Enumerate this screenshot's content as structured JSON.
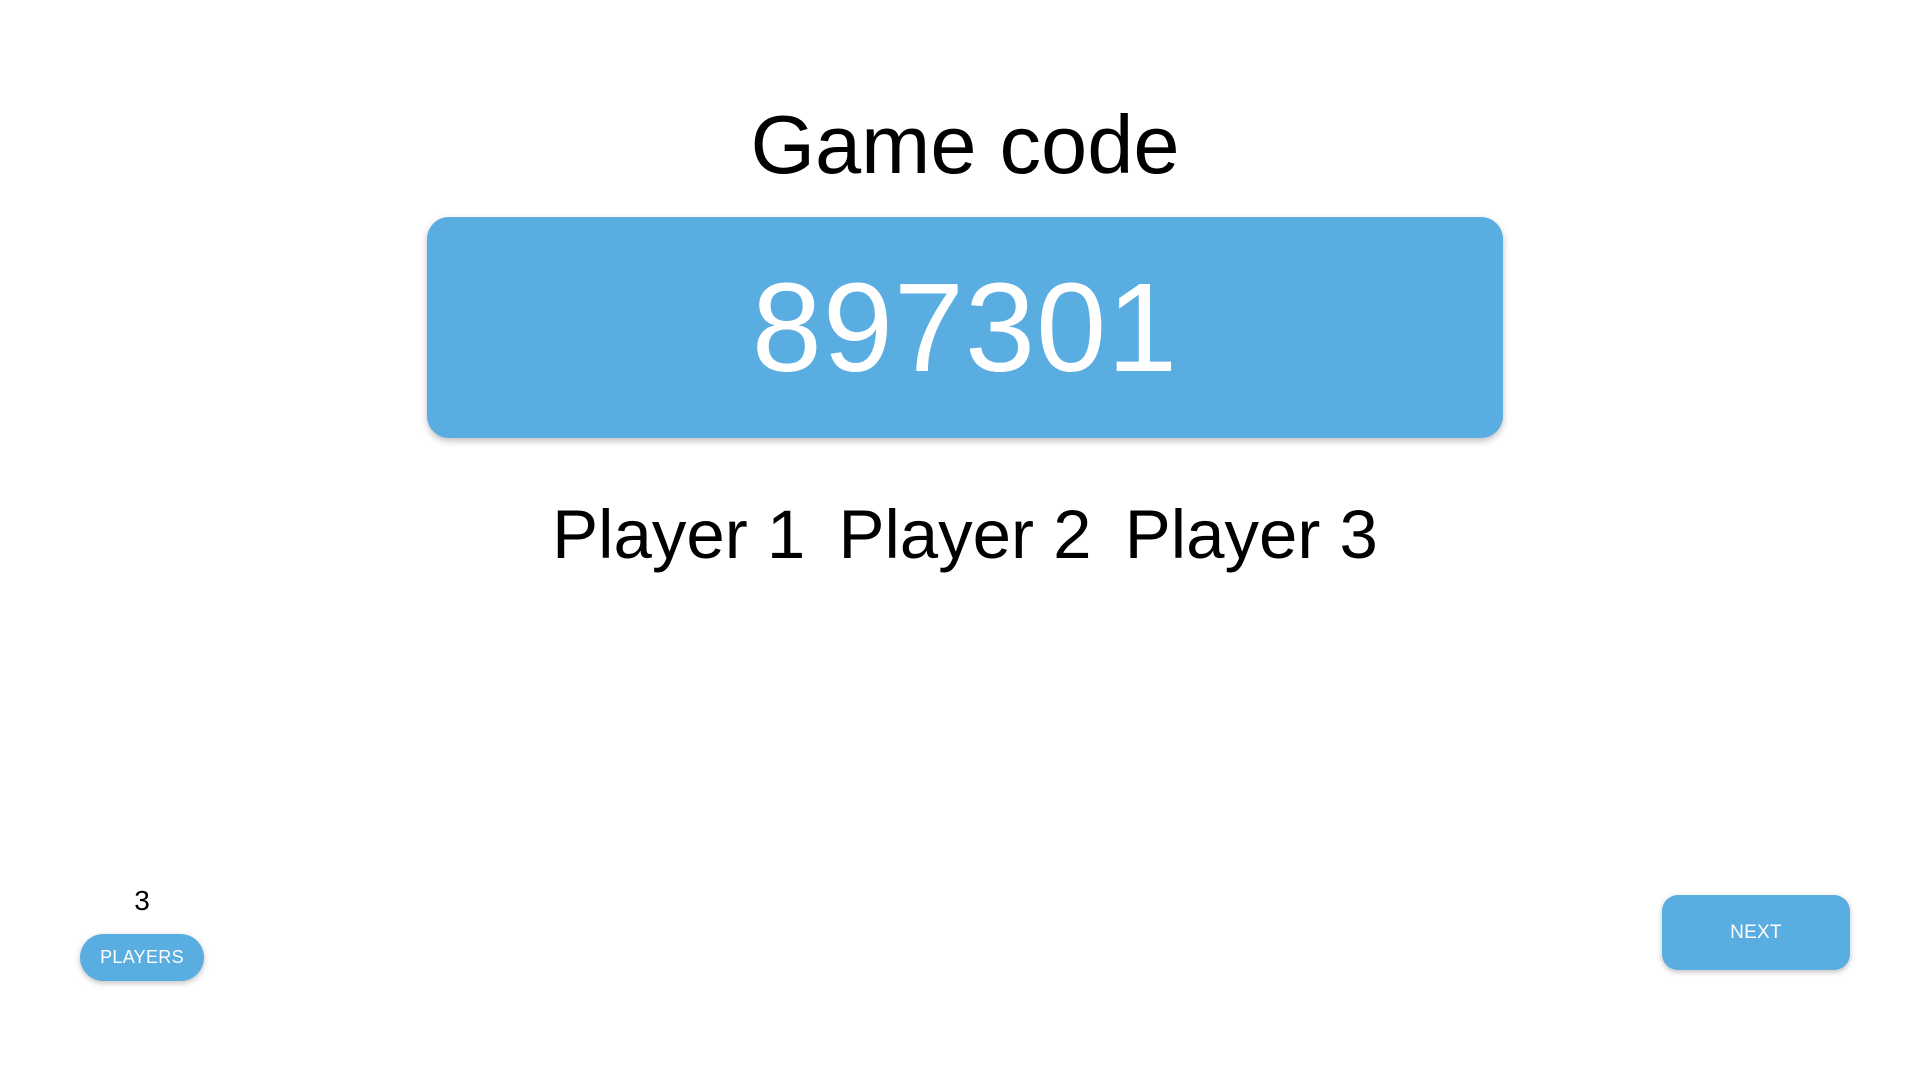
{
  "header": {
    "title": "Game code"
  },
  "game": {
    "code": "897301"
  },
  "players": {
    "names": [
      "Player 1",
      "Player 2",
      "Player 3"
    ],
    "count": "3",
    "button_label": "PLAYERS"
  },
  "controls": {
    "next_label": "NEXT"
  },
  "colors": {
    "accent": "#5aade0",
    "background": "#ffffff",
    "button_text": "#ffffff"
  }
}
